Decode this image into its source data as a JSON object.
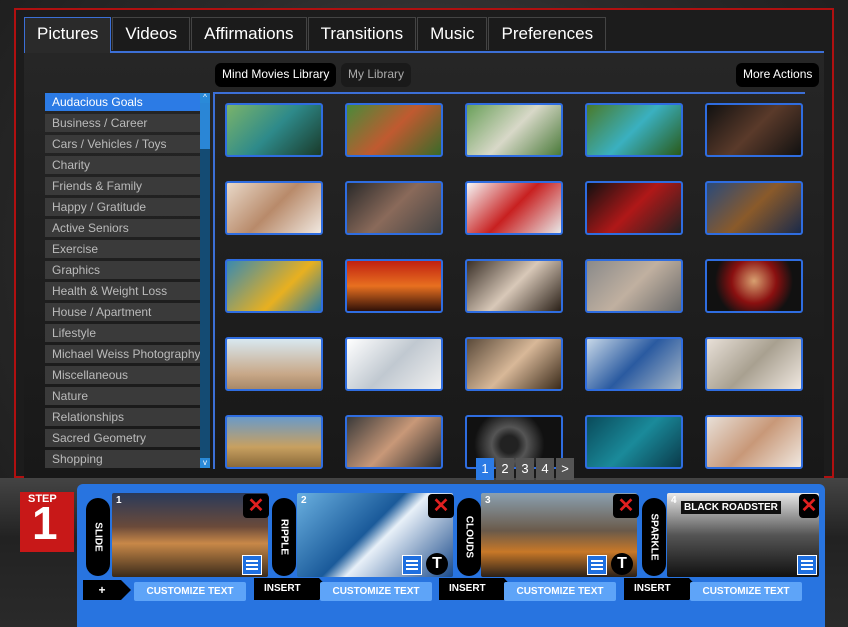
{
  "tabs": [
    "Pictures",
    "Videos",
    "Affirmations",
    "Transitions",
    "Music",
    "Preferences"
  ],
  "library": {
    "mind_movies": "Mind Movies Library",
    "my_library": "My Library",
    "more_actions": "More Actions"
  },
  "categories": [
    "Audacious Goals",
    "Business / Career",
    "Cars / Vehicles / Toys",
    "Charity",
    "Friends & Family",
    "Happy / Gratitude",
    "Active Seniors",
    "Exercise",
    "Graphics",
    "Health & Weight Loss",
    "House / Apartment",
    "Lifestyle",
    "Michael Weiss Photography",
    "Miscellaneous",
    "Nature",
    "Relationships",
    "Sacred Geometry",
    "Shopping"
  ],
  "scroll": {
    "up": "^",
    "down": "v"
  },
  "pagination": [
    "1",
    "2",
    "3",
    "4",
    ">"
  ],
  "step": {
    "label": "STEP",
    "number": "1"
  },
  "slides": [
    {
      "num": "1",
      "transition": "SLIDE"
    },
    {
      "num": "2",
      "transition": "RIPPLE"
    },
    {
      "num": "3",
      "transition": "CLOUDS"
    },
    {
      "num": "4",
      "transition": "SPARKLE",
      "banner": "BLACK ROADSTER"
    }
  ],
  "add_label": "+",
  "customize_label": "CUSTOMIZE TEXT",
  "insert_label": "INSERT",
  "close_glyph": "✕",
  "text_glyph": "T",
  "colors": {
    "accent": "#2c7be5",
    "border_red": "#b01010",
    "strip_blue": "#2874e0"
  }
}
